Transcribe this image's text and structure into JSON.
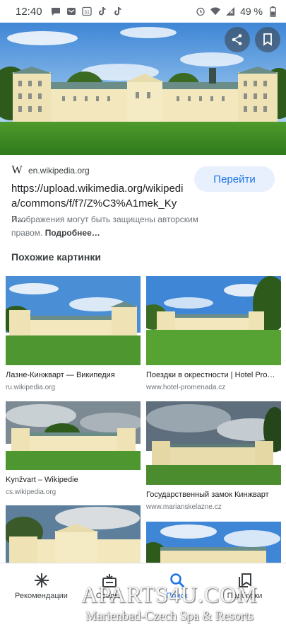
{
  "status_bar": {
    "time": "12:40",
    "battery": "49 %",
    "left_icons": [
      "chat-bubble-icon",
      "mail-icon",
      "calendar-icon",
      "tiktok-icon",
      "tiktok-icon"
    ],
    "calendar_day": "31",
    "right_icons": [
      "alarm-icon",
      "wifi-icon",
      "signal-icon",
      "battery-icon"
    ]
  },
  "hero": {
    "share_icon": "share-icon",
    "save_icon": "bookmark-icon"
  },
  "source": {
    "domain": "en.wikipedia.org",
    "logo": "W",
    "url": "https://upload.wikimedia.org/wikipedia/commons/f/f7/Z%C3%A1mek_Kyn...",
    "url_line1": "https://upload.wikimedia.org/wikipedi",
    "url_line2": "a/commons/f/f7/Z%C3%A1mek_Kyn...",
    "goto_label": "Перейти",
    "notice_text": "Изображения могут быть защищены авторским правом.",
    "notice_more": "Подробнее…"
  },
  "similar": {
    "title": "Похожие картинки",
    "items": [
      {
        "title": "Лазне-Кинжварт — Википедия",
        "domain": "ru.wikipedia.org"
      },
      {
        "title": "Поездки в окрестности | Hotel Promenada",
        "domain": "www.hotel-promenada.cz"
      },
      {
        "title": "Kynžvart – Wikipedie",
        "domain": "cs.wikipedia.org"
      },
      {
        "title": "Государственный замок Кинжварт",
        "domain": "www.marianskelazne.cz"
      }
    ]
  },
  "bottom_nav": {
    "items": [
      {
        "label": "Рекомендации",
        "icon": "asterisk-icon"
      },
      {
        "label": "Сводка",
        "icon": "inbox-icon"
      },
      {
        "label": "Поиск",
        "icon": "search-icon"
      },
      {
        "label": "Подборки",
        "icon": "collections-icon"
      }
    ]
  },
  "watermark": {
    "line1": "APARTS4U.COM",
    "line2": "Marienbad-Czech Spa & Resorts"
  },
  "colors": {
    "accent": "#1a73e8",
    "accent_bg": "#e8f0fe",
    "text_secondary": "#70757a"
  }
}
